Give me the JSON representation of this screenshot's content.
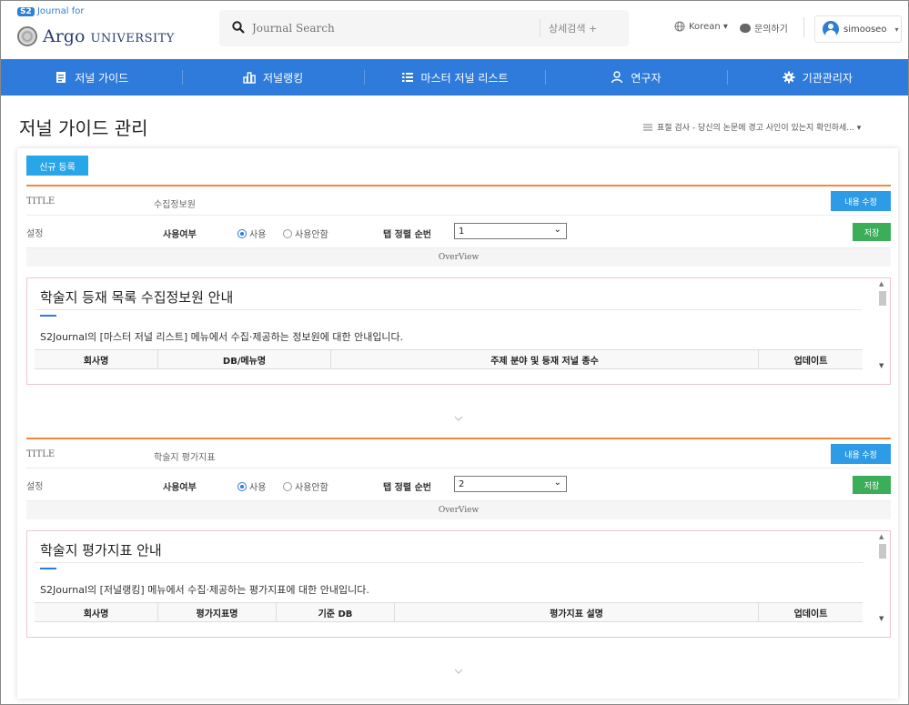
{
  "header": {
    "logo_small": "Journal for",
    "logo_badge": "S2",
    "logo_name": "Argo",
    "logo_suffix": "UNIVERSITY",
    "search_placeholder": "Journal Search",
    "advanced_search": "상세검색 +",
    "language": "Korean ▾",
    "inquiry": "문의하기",
    "user_name": "simooseo",
    "user_caret": "▾"
  },
  "nav": {
    "items": [
      {
        "label": "저널 가이드",
        "icon": "document-icon"
      },
      {
        "label": "저널랭킹",
        "icon": "ranking-icon"
      },
      {
        "label": "마스터 저널 리스트",
        "icon": "list-icon"
      },
      {
        "label": "연구자",
        "icon": "person-icon"
      },
      {
        "label": "기관관리자",
        "icon": "gear-icon"
      }
    ]
  },
  "page": {
    "title": "저널 가이드 관리",
    "notice": "표절 검사 - 당신의 논문에 경고 사인이 있는지 확인하세... ▾",
    "new_button": "신규 등록"
  },
  "sections": [
    {
      "title_label": "TITLE",
      "title_value": "수집정보원",
      "edit_label": "내용 수정",
      "setting_label": "설정",
      "use_label": "사용여부",
      "radio_use": "사용",
      "radio_unused": "사용안함",
      "sort_label": "탭 정렬 순번",
      "sort_value": "1",
      "save_label": "저장",
      "overview_label": "OverView",
      "preview_title": "학술지 등재 목록 수집정보원 안내",
      "preview_desc": "S2Journal의 [마스터 저널 리스트] 메뉴에서 수집·제공하는 정보원에 대한 안내입니다.",
      "columns": [
        "회사명",
        "DB/메뉴명",
        "주제 분야 및 등재 저널 종수",
        "업데이트"
      ]
    },
    {
      "title_label": "TITLE",
      "title_value": "학술지 평가지표",
      "edit_label": "내용 수정",
      "setting_label": "설정",
      "use_label": "사용여부",
      "radio_use": "사용",
      "radio_unused": "사용안함",
      "sort_label": "탭 정렬 순번",
      "sort_value": "2",
      "save_label": "저장",
      "overview_label": "OverView",
      "preview_title": "학술지 평가지표 안내",
      "preview_desc": "S2Journal의 [저널랭킹] 메뉴에서 수집·제공하는 평가지표에 대한 안내입니다.",
      "columns": [
        "회사명",
        "평가지표명",
        "기준 DB",
        "평가지표 설명",
        "업데이트"
      ]
    }
  ],
  "colors": {
    "nav": "#2e7bdb",
    "accent_orange": "#f0883c",
    "edit_button": "#2e9be6",
    "save_button": "#3cae5a",
    "new_button": "#27a6ea"
  }
}
